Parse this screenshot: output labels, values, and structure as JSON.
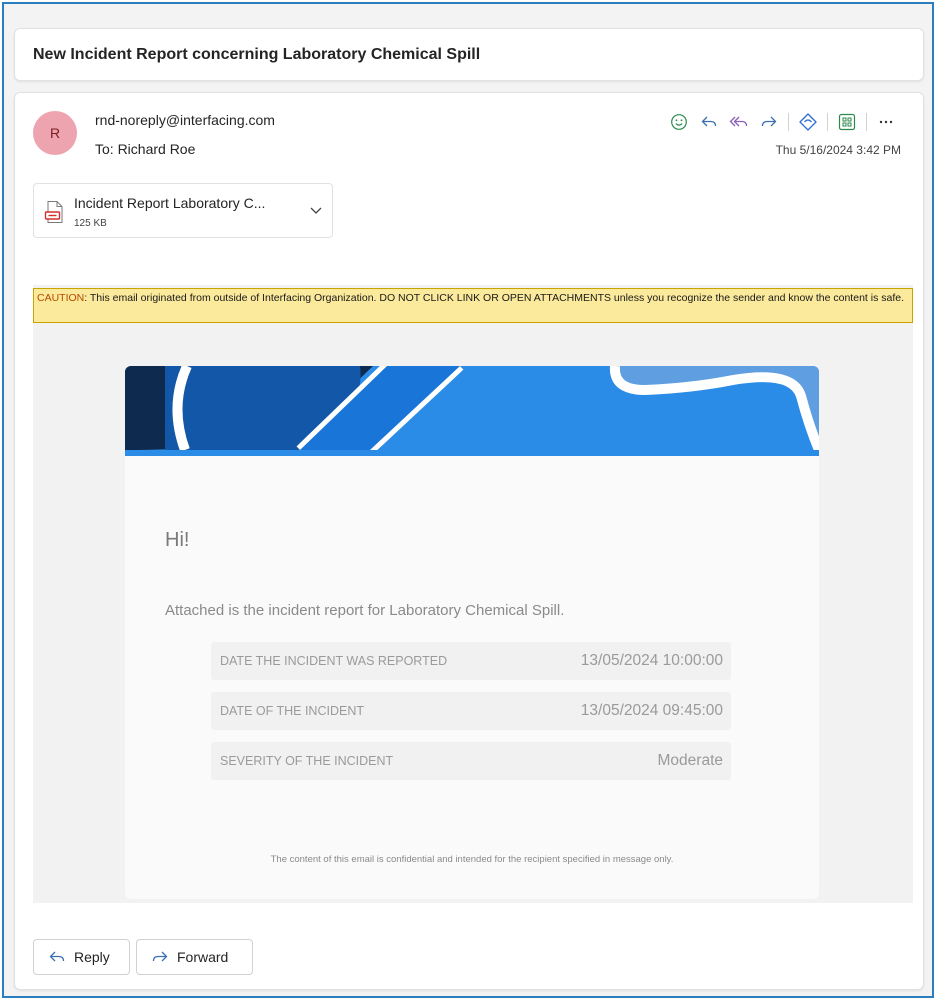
{
  "subject": "New Incident Report concerning Laboratory Chemical Spill",
  "header": {
    "avatar_initial": "R",
    "sender": "rnd-noreply@interfacing.com",
    "to": "To: Richard Roe",
    "date": "Thu 5/16/2024 3:42 PM",
    "toolbar_icons": [
      "emoji-icon",
      "reply-icon",
      "reply-all-icon",
      "forward-icon",
      "loop-icon",
      "apps-icon",
      "more-icon"
    ]
  },
  "attachment": {
    "name": "Incident Report Laboratory C...",
    "size": "125 KB"
  },
  "caution": {
    "label": "CAUTION",
    "text": ": This email originated from outside of Interfacing Organization. DO NOT CLICK LINK OR OPEN ATTACHMENTS unless you recognize the sender and know the content is safe."
  },
  "email_body": {
    "greeting": "Hi!",
    "intro": "Attached is the incident report for Laboratory Chemical Spill.",
    "details": [
      {
        "label": "DATE THE INCIDENT WAS REPORTED",
        "value": "13/05/2024 10:00:00"
      },
      {
        "label": "DATE OF THE INCIDENT",
        "value": "13/05/2024 09:45:00"
      },
      {
        "label": "SEVERITY OF THE INCIDENT",
        "value": "Moderate"
      }
    ],
    "footer": "The content of this email is confidential and intended for the recipient specified in message only."
  },
  "actions": {
    "reply": "Reply",
    "forward": "Forward"
  },
  "colors": {
    "accent": "#2a7dbf",
    "avatar_bg": "#eda4ae",
    "caution_bg": "#fbe99c",
    "banner_blue": "#2b8ce8",
    "banner_navy": "#0e2a4f"
  }
}
